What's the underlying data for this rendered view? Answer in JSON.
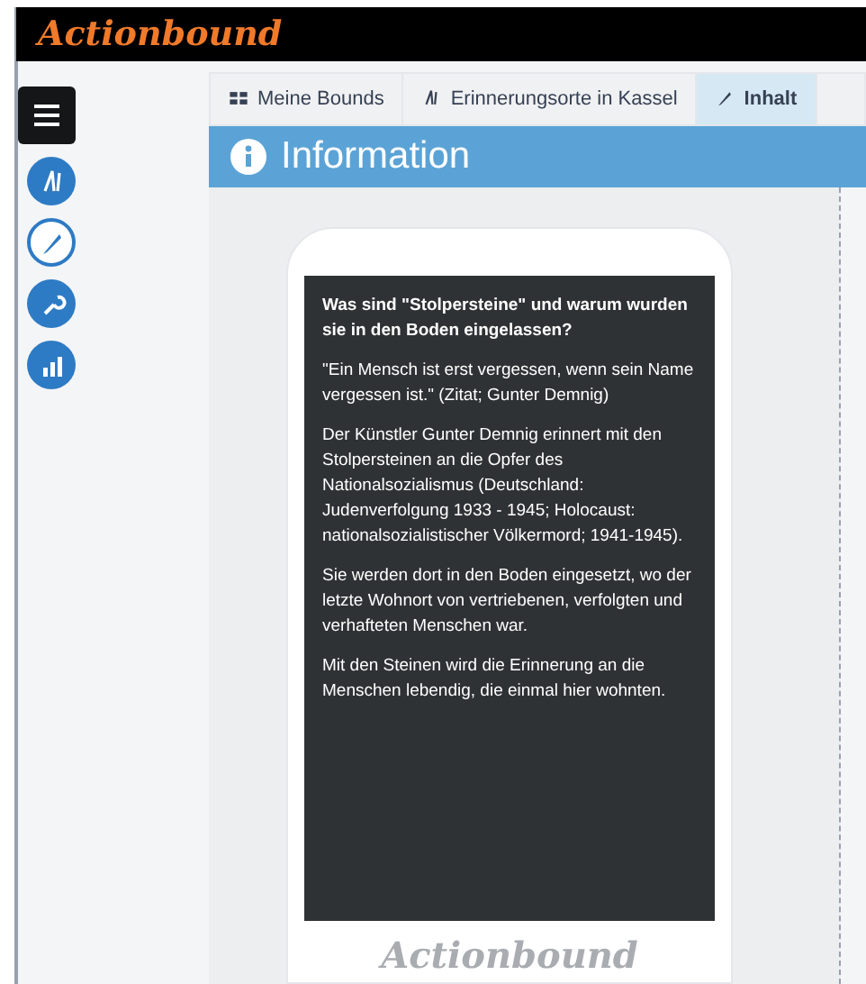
{
  "header": {
    "logo": "Actionbound"
  },
  "sidebar": {
    "items": [
      {
        "kind": "menu",
        "selected": false
      },
      {
        "kind": "bound",
        "selected": false
      },
      {
        "kind": "content",
        "selected": true
      },
      {
        "kind": "tools",
        "selected": false
      },
      {
        "kind": "stats",
        "selected": false
      }
    ]
  },
  "breadcrumb": [
    {
      "label": "Meine Bounds",
      "kind": "grid",
      "selected": false
    },
    {
      "label": "Erinnerungsorte in Kassel",
      "kind": "bound",
      "selected": false
    },
    {
      "label": "Inhalt",
      "kind": "content",
      "selected": true
    }
  ],
  "panel": {
    "title": "Information"
  },
  "phone": {
    "paragraphs": [
      "Was sind \"Stolpersteine\" und warum wurden sie in den Boden eingelassen?",
      "\"Ein Mensch ist erst vergessen, wenn sein Name vergessen ist.\" (Zitat; Gunter Demnig)",
      "Der Künstler Gunter Demnig erinnert mit den Stolpersteinen an die Opfer des Nationalsozialismus (Deutschland: Judenverfolgung 1933 - 1945; Holocaust: nationalsozialistischer Völkermord; 1941-1945).",
      "Sie werden dort in den Boden eingesetzt, wo der letzte Wohnort von vertriebenen, verfolgten und verhafteten Menschen war.",
      "Mit den Steinen wird die Erinnerung an die Menschen lebendig, die einmal hier wohnten."
    ],
    "footer_logo": "Actionbound"
  }
}
